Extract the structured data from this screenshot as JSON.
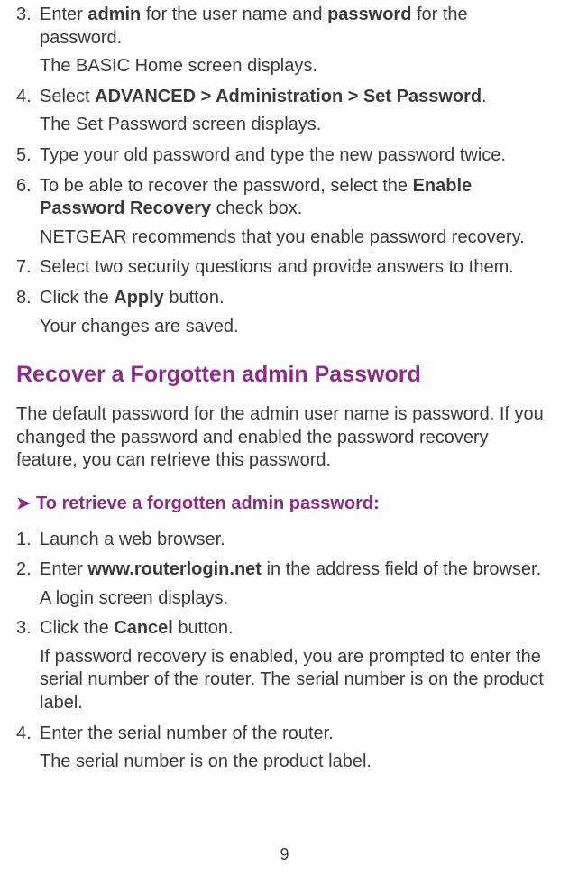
{
  "list1": {
    "items": [
      {
        "num": "3.",
        "parts": [
          {
            "t": "Enter "
          },
          {
            "t": "admin",
            "b": true
          },
          {
            "t": " for the user name and "
          },
          {
            "t": "password",
            "b": true
          },
          {
            "t": " for the password."
          }
        ],
        "after": "The BASIC Home screen displays."
      },
      {
        "num": "4.",
        "parts": [
          {
            "t": "Select "
          },
          {
            "t": "ADVANCED > Administration > Set Password",
            "b": true
          },
          {
            "t": "."
          }
        ],
        "after": "The Set Password screen displays."
      },
      {
        "num": "5.",
        "parts": [
          {
            "t": "Type your old password and type the new password twice."
          }
        ]
      },
      {
        "num": "6.",
        "parts": [
          {
            "t": "To be able to recover the password, select the "
          },
          {
            "t": "Enable Password Recovery",
            "b": true
          },
          {
            "t": " check box."
          }
        ],
        "after": "NETGEAR recommends that you enable password recovery."
      },
      {
        "num": "7.",
        "parts": [
          {
            "t": "Select two security questions and provide answers to them."
          }
        ]
      },
      {
        "num": "8.",
        "parts": [
          {
            "t": "Click the "
          },
          {
            "t": "Apply",
            "b": true
          },
          {
            "t": " button."
          }
        ],
        "after": "Your changes are saved."
      }
    ]
  },
  "section_heading": "Recover a Forgotten admin Password",
  "intro_para": "The default password for the admin user name is password. If you changed the password and enabled the password recovery feature, you can retrieve this password.",
  "proc_arrow": "➤",
  "proc_label": "To retrieve a forgotten admin password:",
  "list2": {
    "items": [
      {
        "num": "1.",
        "parts": [
          {
            "t": "Launch a web browser."
          }
        ]
      },
      {
        "num": "2.",
        "parts": [
          {
            "t": "Enter "
          },
          {
            "t": "www.routerlogin.net",
            "b": true
          },
          {
            "t": " in the address field of the browser."
          }
        ],
        "after": "A login screen displays."
      },
      {
        "num": "3.",
        "parts": [
          {
            "t": "Click the "
          },
          {
            "t": "Cancel",
            "b": true
          },
          {
            "t": " button."
          }
        ],
        "after": "If password recovery is enabled, you are prompted to enter the serial number of the router. The serial number is on the product label."
      },
      {
        "num": "4.",
        "parts": [
          {
            "t": "Enter the serial number of the router."
          }
        ],
        "after": "The serial number is on the product label."
      }
    ]
  },
  "page_number": "9"
}
